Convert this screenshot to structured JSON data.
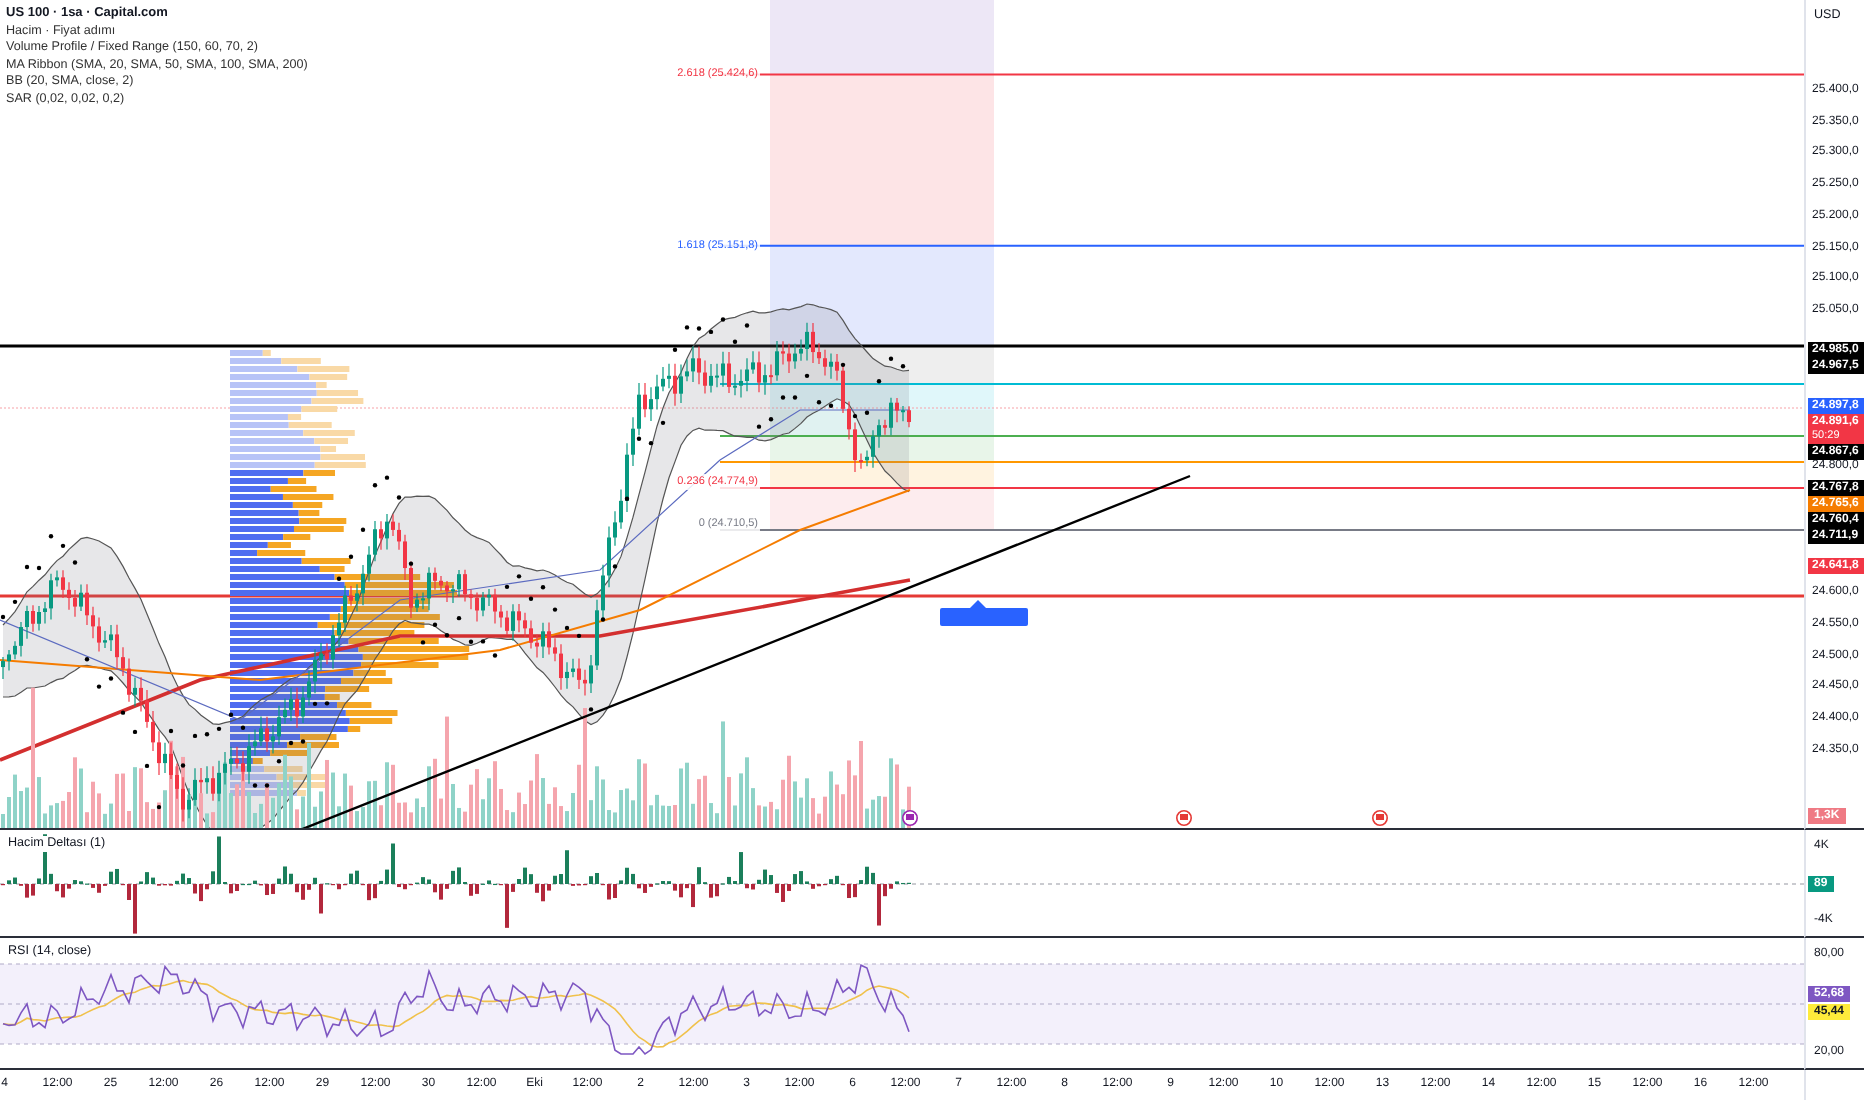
{
  "legend": {
    "symbol": "US 100 · 1sa · Capital.com",
    "indicators": [
      "Hacim · Fiyat adımı",
      "Volume Profile / Fixed Range (150, 60, 70, 2)",
      "MA Ribbon (SMA, 20, SMA, 50, SMA, 100, SMA, 200)",
      "BB (20, SMA, close, 2)",
      "SAR (0,02, 0,02, 0,2)"
    ]
  },
  "fib_levels": [
    {
      "label": "2.618 (25.424,6)",
      "color": "#f23645"
    },
    {
      "label": "1.618 (25.151,8)",
      "color": "#2962ff"
    },
    {
      "label": "0.236 (24.774,9)",
      "color": "#f23645"
    },
    {
      "label": "0 (24.710,5)",
      "color": "#787b86"
    }
  ],
  "price_axis": {
    "currency": "USD",
    "ticks": [
      "25.400,0",
      "25.350,0",
      "25.300,0",
      "25.250,0",
      "25.200,0",
      "25.150,0",
      "25.100,0",
      "25.050,0",
      "24.800,0",
      "24.600,0",
      "24.550,0",
      "24.500,0",
      "24.450,0",
      "24.400,0",
      "24.350,0"
    ],
    "tags": [
      {
        "text": "24.985,0",
        "color": "#000000"
      },
      {
        "text": "24.967,5",
        "color": "#000000"
      },
      {
        "text": "24.897,8",
        "color": "#2962ff"
      },
      {
        "text": "24.891,6",
        "sub": "50:29",
        "color": "#f23645"
      },
      {
        "text": "24.867,6",
        "color": "#000000"
      },
      {
        "text": "24.767,8",
        "color": "#000000"
      },
      {
        "text": "24.765,6",
        "color": "#f57c00"
      },
      {
        "text": "24.760,4",
        "color": "#000000"
      },
      {
        "text": "24.711,9",
        "color": "#000000"
      },
      {
        "text": "24.641,8",
        "color": "#f23645"
      }
    ],
    "volume_tag": "1,3K"
  },
  "delta_pane": {
    "title": "Hacim Deltası (1)",
    "axis": [
      "4K",
      "-4K"
    ],
    "tag": "89"
  },
  "rsi_pane": {
    "title": "RSI (14, close)",
    "axis": [
      "80,00",
      "20,00"
    ],
    "tags": [
      {
        "text": "52,68",
        "color": "#7e57c2"
      },
      {
        "text": "45,44",
        "color": "#ffeb3b"
      }
    ]
  },
  "time_axis": [
    "4",
    "12:00",
    "25",
    "12:00",
    "26",
    "12:00",
    "29",
    "12:00",
    "30",
    "12:00",
    "Eki",
    "12:00",
    "2",
    "12:00",
    "3",
    "12:00",
    "6",
    "12:00",
    "7",
    "12:00",
    "8",
    "12:00",
    "9",
    "12:00",
    "10",
    "12:00",
    "13",
    "12:00",
    "14",
    "12:00",
    "15",
    "12:00",
    "16",
    "12:00"
  ]
}
